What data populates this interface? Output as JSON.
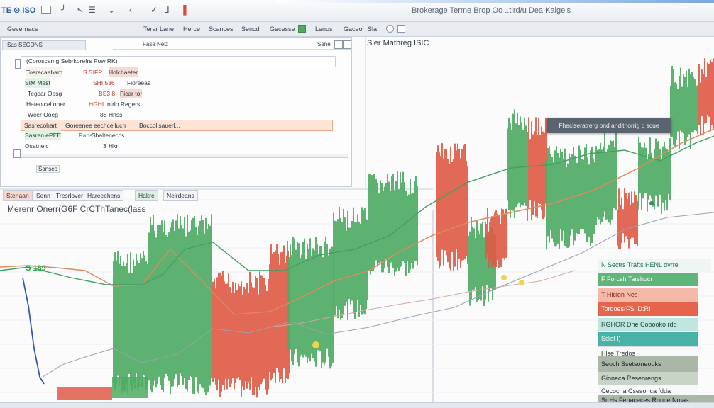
{
  "titlebar": {
    "app_logo": "TE ⊙ ISO",
    "window_title": "Brokerage Terme Brop Oo ..tlrd/u  Dea Kalgels",
    "icons": [
      "minimize-square",
      "pin",
      "menu-lines",
      "chevron",
      "chevron",
      "check",
      "tick",
      "flag"
    ]
  },
  "toolbar": {
    "items": [
      "Gevernacs",
      "Terar Lane",
      "Herce",
      "Scances",
      "Sencd",
      "Gecesse",
      "Lenos",
      "Gaceo",
      "Sla"
    ]
  },
  "order_panel": {
    "tab_label": "Sas SECONS",
    "header_items": [
      "Fase Nelz",
      "Sene"
    ],
    "header_caption": "(Coroscamg Sebrkorefrs Pow RK)",
    "rows": [
      {
        "label": "Tosrecaeham",
        "value": "S SIFR",
        "note": "Holchaeter"
      },
      {
        "label": "SIM  Mest",
        "value": "SHI 536",
        "note": "Fioreeas"
      },
      {
        "label": "Tegsar Oesg",
        "value": "BS3 8",
        "note": "Ficar tor"
      },
      {
        "label": "Hateolcel oner",
        "value": "HGHI",
        "note": "ntrlo Regers"
      },
      {
        "label": "Wcer Ooeg",
        "value": "88",
        "note": "Hnss"
      },
      {
        "label": "Sasrecohart",
        "value": "Goreenee eechcellucrr",
        "note": "Boccolisauerl..."
      },
      {
        "label": "Sasren ePEE",
        "value": "Pans",
        "note": "Sbalteneccs"
      },
      {
        "label": "Osatnelc",
        "value": "3",
        "note": "Hkr"
      }
    ],
    "footer_button": "Sanseo"
  },
  "chart": {
    "title": "Sler Mathreg ISIC",
    "callout": "Fheclseratrerg ond andithorrig d scue",
    "indicator_tabs": [
      "Stenaan",
      "Senn",
      "Tresrlover",
      "Hareeehens",
      "Hakre",
      "Neirdeans"
    ],
    "indicator_title": "Merenr  Onerr(G6F CrCThTanec(lass",
    "value_label": "S 189",
    "colors": {
      "up": "#4eab62",
      "down": "#df5a45",
      "ma_orange": "#e08a5c",
      "ma_green": "#3fa064",
      "ma_blue": "#3357b8"
    }
  },
  "side_panel": {
    "rows": [
      {
        "text": "N  Sectrs  Trafts  HENL dvrre",
        "style": "header"
      },
      {
        "text": "F  Forcsh Tarshocr",
        "style": "green"
      },
      {
        "text": "T  Hiclon Nes",
        "style": "red-light"
      },
      {
        "text": "Tordoes(FS. D:RI",
        "style": "red"
      },
      {
        "text": "RGHOR   Dhe   Cooooko rdo",
        "style": "teal-light"
      },
      {
        "text": "Sdisf l)",
        "style": "teal"
      },
      {
        "text": "Hlse Tredos",
        "style": "plain"
      },
      {
        "text": "Seoch Ssetsoneooks",
        "style": "gray-green"
      },
      {
        "text": "Gioneca Reseorengs",
        "style": "gray-green2"
      },
      {
        "text": "Cecocha Csesonca fdda",
        "style": "plain"
      },
      {
        "text": "Sr Hs Fenaceces Ronce Nmas",
        "style": "gray-green"
      }
    ]
  }
}
